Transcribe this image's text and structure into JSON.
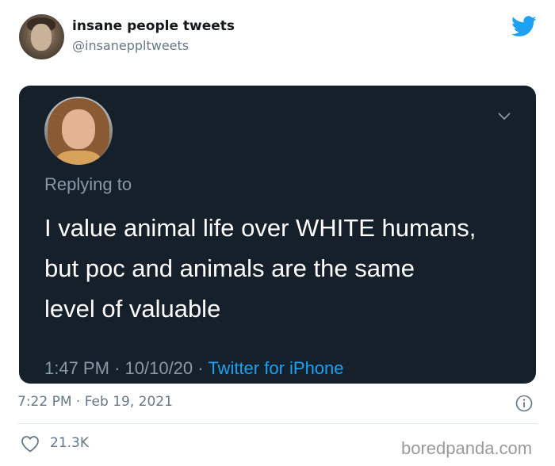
{
  "author": {
    "display_name": "insane people tweets",
    "handle": "@insanepp​ltweets"
  },
  "icons": {
    "logo": "twitter-bird-icon",
    "menu": "chevron-down-icon",
    "info": "info-icon",
    "like": "heart-icon"
  },
  "quoted_screenshot": {
    "replying_to_label": "Replying to",
    "text": "I value animal life over WHITE humans,\nbut poc and animals are the same\nlevel of valuable",
    "time": "1:47 PM",
    "date": "10/10/20",
    "separator": "·",
    "source": "Twitter for iPhone"
  },
  "tweet_meta": {
    "timestamp": "7:22 PM · Feb 19, 2021",
    "likes": "21.3K"
  },
  "watermark": "boredpanda.com",
  "colors": {
    "twitter_blue": "#1da1f2",
    "dark_card": "#15202b",
    "muted": "#657786"
  }
}
